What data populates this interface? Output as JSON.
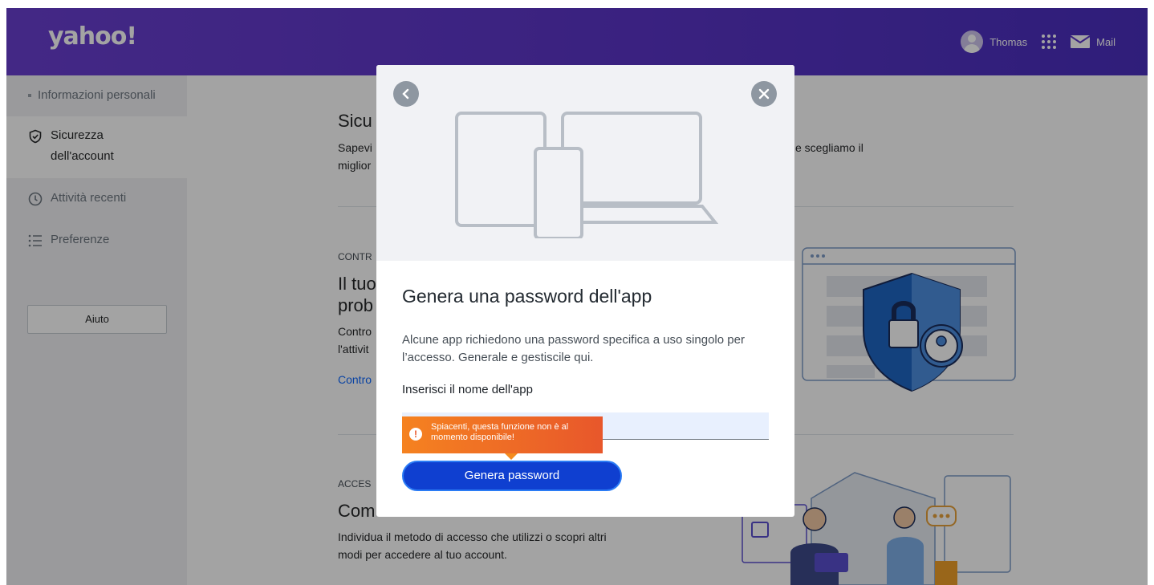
{
  "header": {
    "logo": "yahoo!",
    "user_name": "Thomas",
    "mail_label": "Mail"
  },
  "sidebar": {
    "items": [
      {
        "label": "Informazioni personali"
      },
      {
        "label": "Sicurezza dell'account"
      },
      {
        "label": "Attività recenti"
      },
      {
        "label": "Preferenze"
      }
    ],
    "help_label": "Aiuto"
  },
  "main": {
    "section1_title": "Sicu",
    "section1_desc_line1_a": "Sapevi",
    "section1_desc_line1_b": "e scegliamo il",
    "section1_desc_line2": "miglior",
    "section2_kicker": "CONTR",
    "section2_title_line1": "Il tuo",
    "section2_title_line2": "prob",
    "section2_desc_line1": "Contro",
    "section2_desc_line2": "l'attivit",
    "section2_link": "Contro",
    "section3_kicker": "ACCES",
    "section3_title": "Com",
    "section3_desc_line1": "Individua il metodo di accesso che utilizzi o scopri altri",
    "section3_desc_line2": "modi per accedere al tuo account."
  },
  "modal": {
    "title": "Genera una password dell'app",
    "description": "Alcune app richiedono una password specifica a uso singolo per l’accesso. Generale e gestiscile qui.",
    "field_label": "Inserisci il nome dell'app",
    "input_value": "",
    "tooltip": "Spiacenti, questa funzione non è al momento disponibile!",
    "button_label": "Genera password"
  },
  "colors": {
    "header_gradient_start": "#6a3fd1",
    "header_gradient_end": "#4a2fbf",
    "primary_button": "#0f3fd0",
    "tooltip_orange": "#f58220",
    "link_blue": "#0f69ff"
  }
}
